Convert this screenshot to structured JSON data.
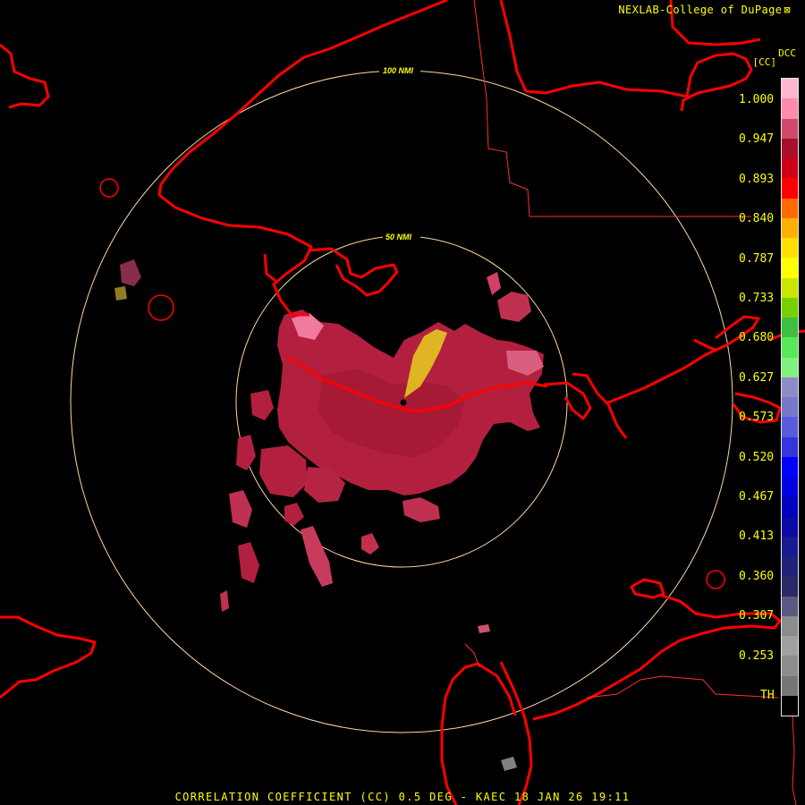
{
  "header": {
    "credit": "NEXLAB-College of DuPage",
    "product_code": "DCC",
    "unit_label": "[CC]"
  },
  "legend": {
    "ticks": [
      "1.000",
      "0.947",
      "0.893",
      "0.840",
      "0.787",
      "0.733",
      "0.680",
      "0.627",
      "0.573",
      "0.520",
      "0.467",
      "0.413",
      "0.360",
      "0.307",
      "0.253",
      "TH"
    ],
    "colors": [
      "#ffb7d0",
      "#ff8ca8",
      "#d24a6a",
      "#a8102a",
      "#cf0018",
      "#ff0000",
      "#ff6a00",
      "#ffb000",
      "#ffe000",
      "#ffff00",
      "#c8e600",
      "#78d000",
      "#3fbf3f",
      "#58e858",
      "#80f080",
      "#8c8cc8",
      "#7777cc",
      "#5a5adc",
      "#3535dc",
      "#0000ff",
      "#0000e0",
      "#0000c0",
      "#0a0aa8",
      "#1a1a90",
      "#22227a",
      "#2a2a66",
      "#5a5a80",
      "#8c8c8c",
      "#a0a0a0",
      "#8c8c8c",
      "#767676",
      "#000000"
    ]
  },
  "rings": {
    "inner_label": "50 NMI",
    "outer_label": "100 NMI",
    "color": "#ffd7a0"
  },
  "map": {
    "coastline_color": "#ff0000",
    "border_color": "#ff3030"
  },
  "radar": {
    "site": "KAEC",
    "product": "CORRELATION COEFFICIENT (CC)",
    "tilt": "0.5 DEG",
    "date": "18 JAN 26",
    "time": "19:11"
  },
  "footer": {
    "text": "CORRELATION COEFFICIENT (CC) 0.5 DEG - KAEC 18 JAN 26 19:11"
  }
}
